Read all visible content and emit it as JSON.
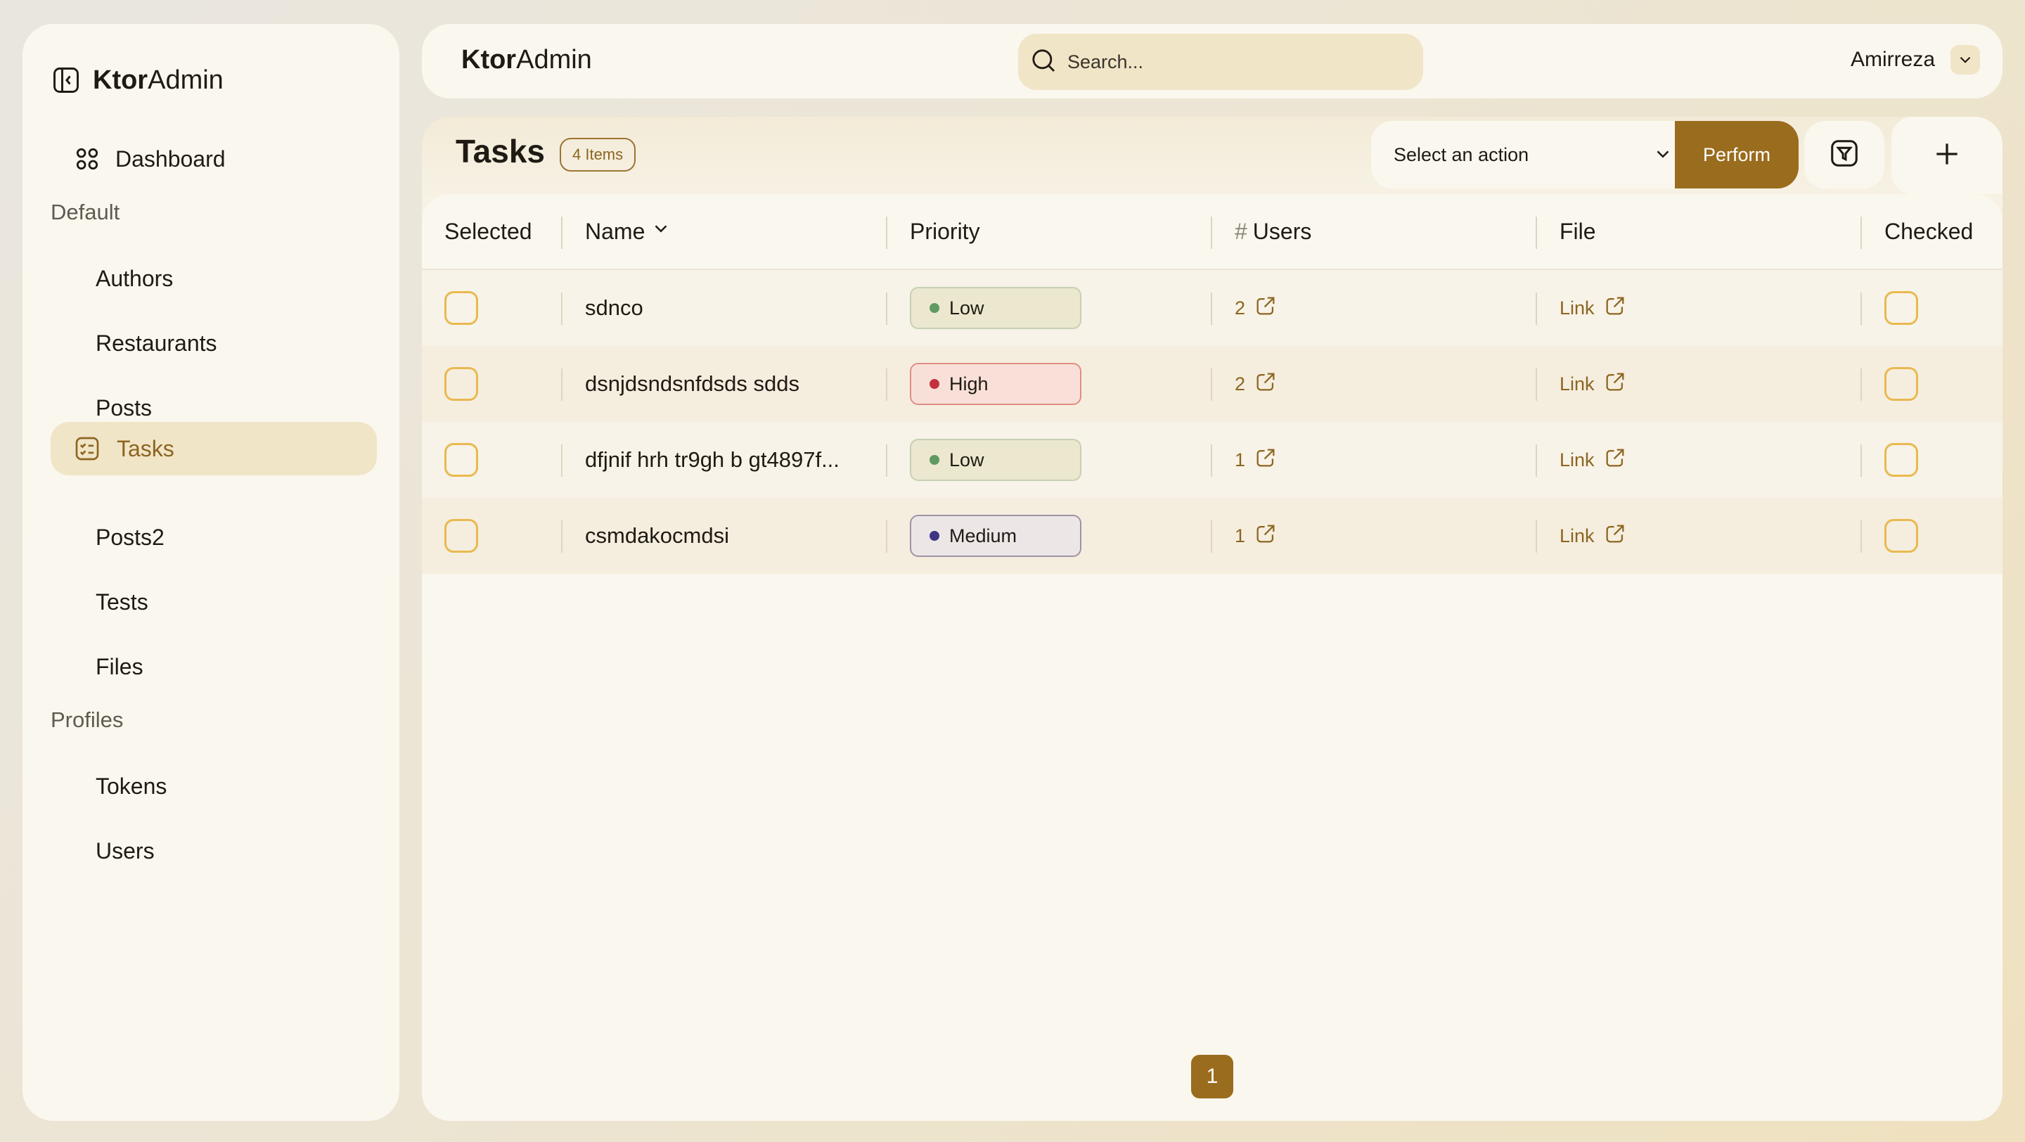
{
  "app": {
    "brand_bold": "Ktor",
    "brand_rest": "Admin"
  },
  "sidebar": {
    "dashboard": "Dashboard",
    "sections": [
      {
        "title": "Default",
        "items": [
          "Authors",
          "Restaurants",
          "Posts",
          "Tasks",
          "Posts2",
          "Tests",
          "Files"
        ]
      },
      {
        "title": "Profiles",
        "items": [
          "Tokens",
          "Users"
        ]
      }
    ],
    "active": "Tasks"
  },
  "topbar": {
    "search_placeholder": "Search...",
    "user": "Amirreza"
  },
  "page": {
    "title": "Tasks",
    "count_badge": "4 Items",
    "action_select": "Select an action",
    "perform": "Perform"
  },
  "table": {
    "columns": [
      "Selected",
      "Name",
      "Priority",
      "Users",
      "File",
      "Checked"
    ],
    "users_prefix": "#",
    "rows": [
      {
        "name": "sdnco",
        "priority": "Low",
        "priority_color": "#5f9a63",
        "users": "2",
        "file": "Link"
      },
      {
        "name": "dsnjdsndsnfdsds sdds",
        "priority": "High",
        "priority_color": "#c2323d",
        "users": "2",
        "file": "Link"
      },
      {
        "name": "dfjnif hrh tr9gh b gt4897f...",
        "priority": "Low",
        "priority_color": "#5f9a63",
        "users": "1",
        "file": "Link"
      },
      {
        "name": "csmdakocmdsi",
        "priority": "Medium",
        "priority_color": "#3e3584",
        "users": "1",
        "file": "Link"
      }
    ]
  },
  "pagination": {
    "current": "1"
  },
  "colors": {
    "accent": "#9a6c1e",
    "checkbox": "#e9b94f",
    "active_bg": "#f1e5c8"
  }
}
